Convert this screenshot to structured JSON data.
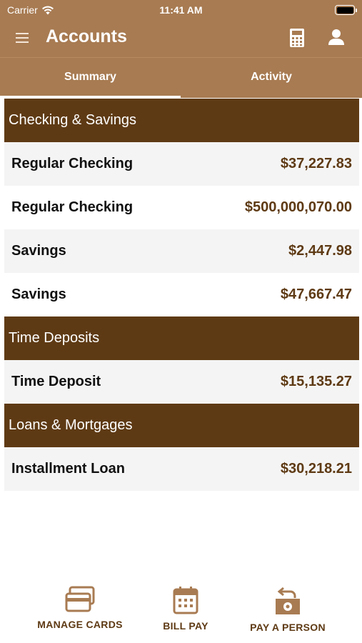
{
  "status_bar": {
    "carrier": "Carrier",
    "time": "11:41 AM"
  },
  "nav": {
    "title": "Accounts",
    "left_icon": "menu-icon",
    "right_icons": [
      "calculator-icon",
      "user-icon"
    ]
  },
  "tabs": [
    {
      "label": "Summary",
      "selected": true
    },
    {
      "label": "Activity",
      "selected": false
    }
  ],
  "sections": [
    {
      "title": "Checking & Savings",
      "accounts": [
        {
          "name": "Regular Checking",
          "amount": "$37,227.83"
        },
        {
          "name": "Regular Checking",
          "amount": "$500,000,070.00"
        },
        {
          "name": "Savings",
          "amount": "$2,447.98"
        },
        {
          "name": "Savings",
          "amount": "$47,667.47"
        }
      ]
    },
    {
      "title": "Time Deposits",
      "accounts": [
        {
          "name": "Time Deposit",
          "amount": "$15,135.27"
        }
      ]
    },
    {
      "title": "Loans & Mortgages",
      "accounts": [
        {
          "name": "Installment Loan",
          "amount": "$30,218.21"
        }
      ]
    }
  ],
  "bottom_nav": [
    {
      "label": "MANAGE CARDS",
      "icon": "cards-icon"
    },
    {
      "label": "BILL PAY",
      "icon": "calendar-icon"
    },
    {
      "label": "PAY A PERSON",
      "icon": "money-transfer-icon"
    }
  ],
  "colors": {
    "header": "#a87b52",
    "section": "#5e3a14",
    "accent_text": "#5e3a14",
    "row_alt": "#f4f4f4"
  }
}
